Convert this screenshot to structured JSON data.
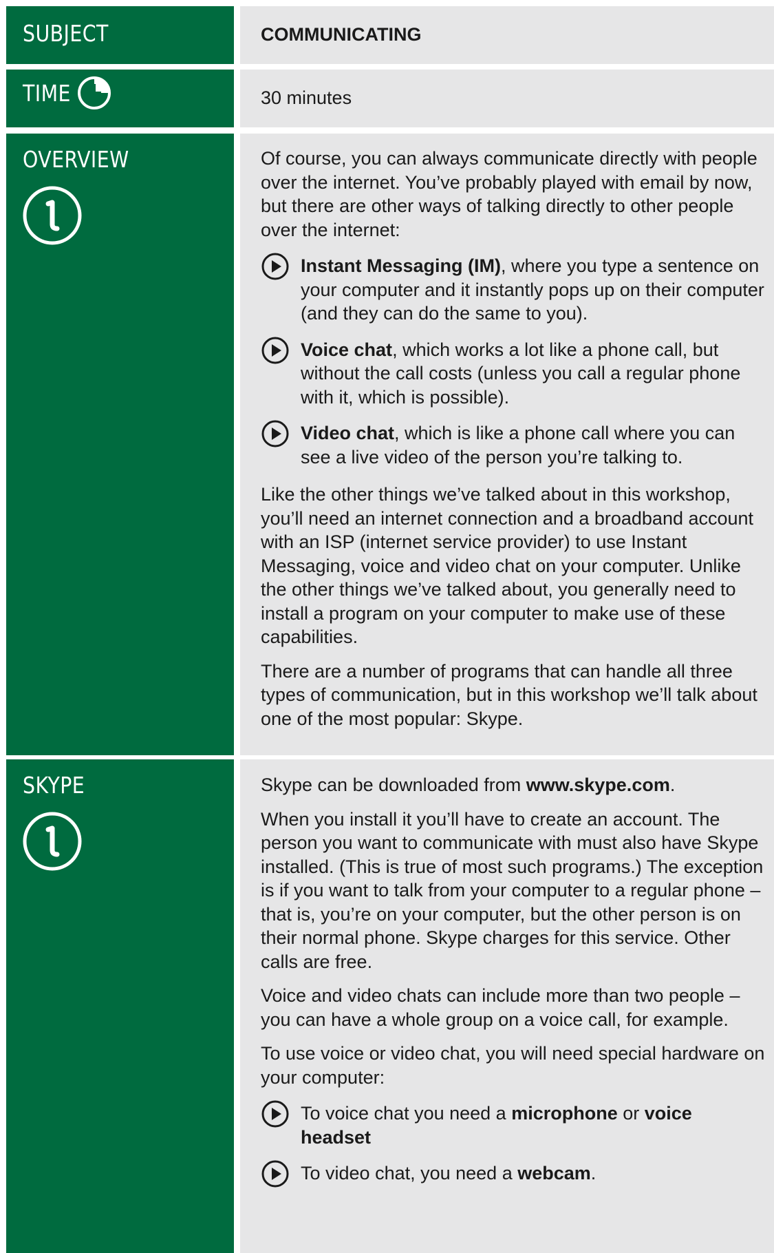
{
  "subject": {
    "label": "SUBJECT",
    "value": "COMMUNICATING"
  },
  "time": {
    "label": "TIME",
    "value": "30 minutes"
  },
  "overview": {
    "label": "OVERVIEW",
    "intro": "Of course, you can always communicate directly with people over the internet. You’ve probably played with email by now, but there are other ways of talking directly to other people over the internet:",
    "bullets": [
      {
        "bold": "Instant Messaging (IM)",
        "text": ", where you type a sentence on your computer and it instantly pops up on their computer (and they can do the same to you)."
      },
      {
        "bold": "Voice chat",
        "text": ", which works a lot like a phone call, but without the call costs (unless you call a regular phone with it, which is possible)."
      },
      {
        "bold": "Video chat",
        "text": ", which is like a phone call where you can see a live video of the person you’re talking to."
      }
    ],
    "para2": "Like the other things we’ve talked about in this workshop, you’ll need an internet connection and a broadband account with an ISP (internet service provider) to use Instant Messaging, voice and video chat on your computer. Unlike the other things we’ve talked about, you generally need to install a program on your computer to make use of these capabilities.",
    "para3": "There are a number of programs that can handle all three types of communication, but in this workshop we’ll talk about one of the most popular: Skype."
  },
  "skype": {
    "label": "SKYPE",
    "p1_pre": "Skype can be downloaded from ",
    "p1_bold": "www.skype.com",
    "p1_post": ".",
    "p2": "When you install it you’ll have to create an account. The person you want to communicate with must also have Skype installed. (This is true of most such programs.) The exception is if you want to talk from your computer to a regular phone – that is, you’re on your computer, but the other person is on their normal phone. Skype charges for this service. Other calls are free.",
    "p3": "Voice and video chats can include more than two people – you can have a whole group on a voice call, for example.",
    "p4": "To use voice or video chat, you will need special hardware on your computer:",
    "b1_pre": "To voice chat you need a ",
    "b1_bold1": "microphone",
    "b1_mid": " or ",
    "b1_bold2": "voice headset",
    "b2_pre": "To video chat, you need a ",
    "b2_bold": "webcam",
    "b2_post": "."
  },
  "colors": {
    "label_green": "#006b3f",
    "content_grey": "#e6e6e7"
  },
  "icons": [
    "clock-icon",
    "info-icon",
    "play-bullet-icon"
  ]
}
